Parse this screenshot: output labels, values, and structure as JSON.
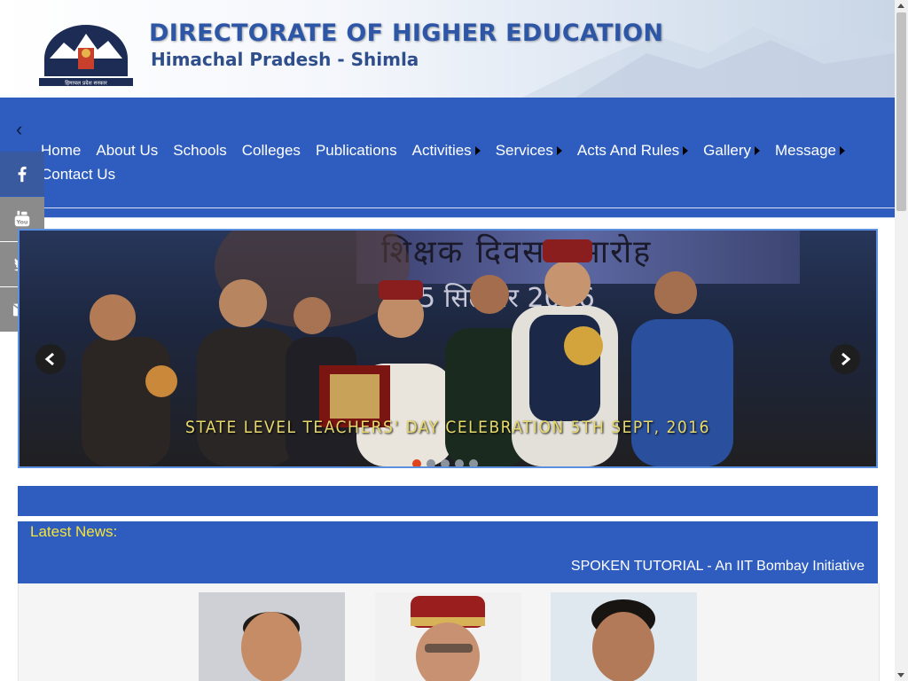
{
  "header": {
    "title": "DIRECTORATE OF HIGHER EDUCATION",
    "subtitle": "Himachal Pradesh - Shimla",
    "logo_text": "हिमाचल प्रदेश सरकार"
  },
  "nav": {
    "items": [
      {
        "label": "Home",
        "has_submenu": false
      },
      {
        "label": "About Us",
        "has_submenu": false
      },
      {
        "label": "Schools",
        "has_submenu": false
      },
      {
        "label": "Colleges",
        "has_submenu": false
      },
      {
        "label": "Publications",
        "has_submenu": false
      },
      {
        "label": "Activities",
        "has_submenu": true
      },
      {
        "label": "Services",
        "has_submenu": true
      },
      {
        "label": "Acts And Rules",
        "has_submenu": true
      },
      {
        "label": "Gallery",
        "has_submenu": true
      },
      {
        "label": "Message",
        "has_submenu": true
      },
      {
        "label": "Contact Us",
        "has_submenu": false
      }
    ]
  },
  "social": [
    "facebook-icon",
    "youtube-icon",
    "twitter-icon",
    "email-icon"
  ],
  "slider": {
    "banner_text": "शिक्षक दिवस समारोह",
    "banner_date": "5 सितम्बर 2016",
    "caption": "STATE LEVEL TEACHERS' DAY CELEBRATION 5TH SEPT, 2016",
    "slide_count": 5,
    "active_slide": 1
  },
  "news": {
    "label": "Latest News:",
    "ticker": "SPOKEN TUTORIAL - An IIT Bombay Initiative"
  },
  "colors": {
    "nav_blue": "#2f5dbf",
    "title_blue": "#2e56a6",
    "news_label": "#f4e43a",
    "caption_gold": "#e7d96b",
    "active_dot": "#e0441b"
  }
}
